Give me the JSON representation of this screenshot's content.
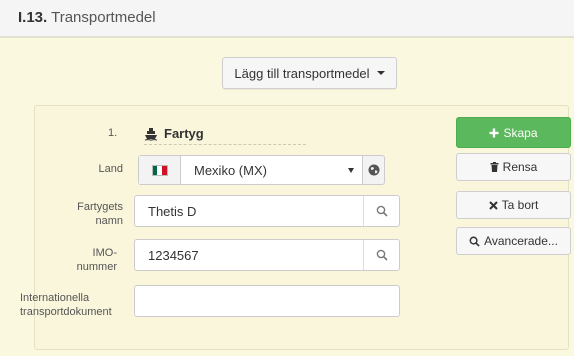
{
  "section": {
    "number": "I.13.",
    "title": "Transportmedel"
  },
  "add_button": {
    "label": "Lägg till transportmedel"
  },
  "entry": {
    "index": "1.",
    "type_label": "Fartyg",
    "country": {
      "label": "Land",
      "value": "Mexiko (MX)",
      "flag_colors": [
        "#006847",
        "#ffffff",
        "#ce1126"
      ]
    },
    "vessel_name": {
      "label_line1": "Fartygets",
      "label_line2": "namn",
      "value": "Thetis D"
    },
    "imo": {
      "label_line1": "IMO-",
      "label_line2": "nummer",
      "value": "1234567"
    },
    "intl_docs": {
      "label_line1": "Internationella",
      "label_line2": "transportdokument",
      "value": ""
    }
  },
  "actions": {
    "create": {
      "label": "Skapa",
      "icon": "plus-icon"
    },
    "clear": {
      "label": "Rensa",
      "icon": "trash-icon"
    },
    "remove": {
      "label": "Ta bort",
      "icon": "times-icon"
    },
    "advanced": {
      "label": "Avancerade...",
      "icon": "search-icon"
    }
  }
}
